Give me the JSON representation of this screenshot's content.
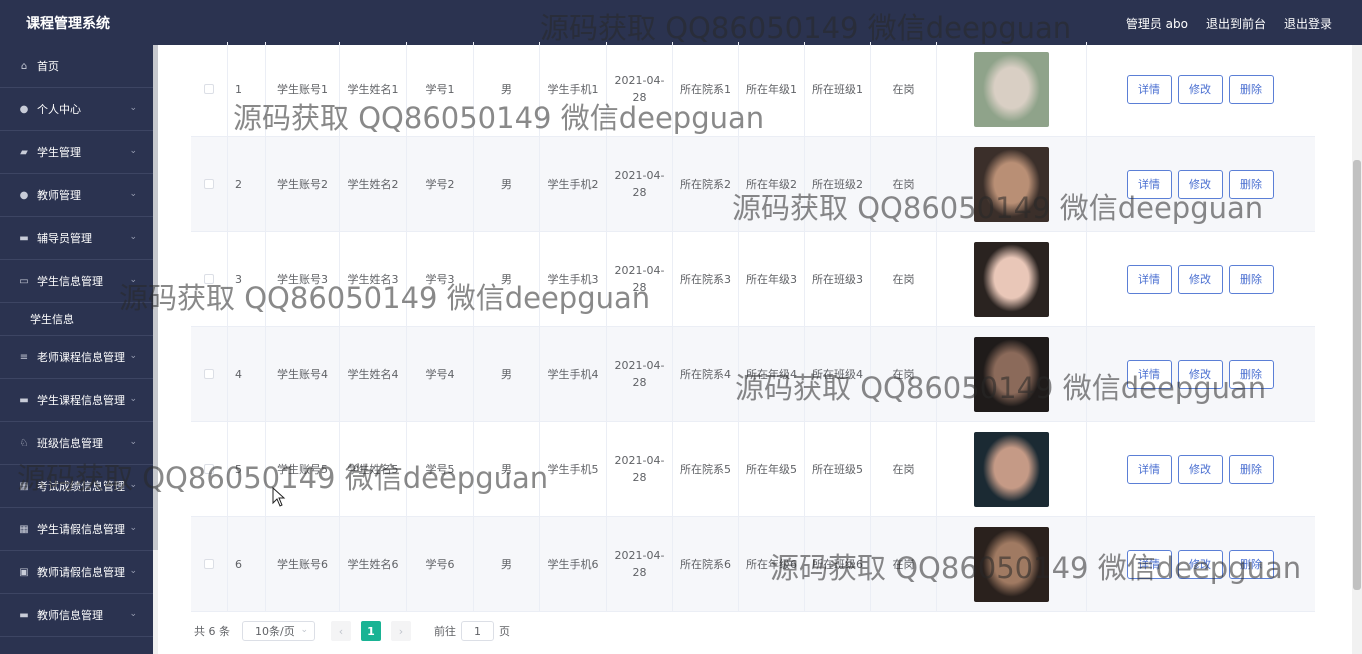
{
  "app": {
    "title": "课程管理系统"
  },
  "header": {
    "user": "管理员 abo",
    "front": "退出到前台",
    "logout": "退出登录"
  },
  "sidebar": {
    "items": [
      {
        "label": "首页",
        "icon": "home-icon",
        "glyph": "⌂"
      },
      {
        "label": "个人中心",
        "icon": "user-icon",
        "glyph": "●"
      },
      {
        "label": "学生管理",
        "icon": "student-icon",
        "glyph": "▰"
      },
      {
        "label": "教师管理",
        "icon": "teacher-icon",
        "glyph": "●"
      },
      {
        "label": "辅导员管理",
        "icon": "counselor-icon",
        "glyph": "▬"
      },
      {
        "label": "学生信息管理",
        "icon": "message-icon",
        "glyph": "▭"
      },
      {
        "label": "老师课程信息管理",
        "icon": "list-icon",
        "glyph": "≡"
      },
      {
        "label": "学生课程信息管理",
        "icon": "monitor-icon",
        "glyph": "▬"
      },
      {
        "label": "班级信息管理",
        "icon": "bell-icon",
        "glyph": "♘"
      },
      {
        "label": "考试成绩信息管理",
        "icon": "grid-icon",
        "glyph": "▦"
      },
      {
        "label": "学生请假信息管理",
        "icon": "grid-icon",
        "glyph": "▦"
      },
      {
        "label": "教师请假信息管理",
        "icon": "clipboard-icon",
        "glyph": "▣"
      },
      {
        "label": "教师信息管理",
        "icon": "monitor-icon",
        "glyph": "▬"
      }
    ],
    "sub_item": "学生信息"
  },
  "table": {
    "rows": [
      {
        "idx": "1",
        "account": "学生账号1",
        "name": "学生姓名1",
        "no": "学号1",
        "sex": "男",
        "phone": "学生手机1",
        "date1": "2021-04-",
        "date2": "28",
        "dept": "所在院系1",
        "grade": "所在年级1",
        "cls": "所在班级1",
        "status": "在岗"
      },
      {
        "idx": "2",
        "account": "学生账号2",
        "name": "学生姓名2",
        "no": "学号2",
        "sex": "男",
        "phone": "学生手机2",
        "date1": "2021-04-",
        "date2": "28",
        "dept": "所在院系2",
        "grade": "所在年级2",
        "cls": "所在班级2",
        "status": "在岗"
      },
      {
        "idx": "3",
        "account": "学生账号3",
        "name": "学生姓名3",
        "no": "学号3",
        "sex": "男",
        "phone": "学生手机3",
        "date1": "2021-04-",
        "date2": "28",
        "dept": "所在院系3",
        "grade": "所在年级3",
        "cls": "所在班级3",
        "status": "在岗"
      },
      {
        "idx": "4",
        "account": "学生账号4",
        "name": "学生姓名4",
        "no": "学号4",
        "sex": "男",
        "phone": "学生手机4",
        "date1": "2021-04-",
        "date2": "28",
        "dept": "所在院系4",
        "grade": "所在年级4",
        "cls": "所在班级4",
        "status": "在岗"
      },
      {
        "idx": "5",
        "account": "学生账号5",
        "name": "学生姓名5",
        "no": "学号5",
        "sex": "男",
        "phone": "学生手机5",
        "date1": "2021-04-",
        "date2": "28",
        "dept": "所在院系5",
        "grade": "所在年级5",
        "cls": "所在班级5",
        "status": "在岗"
      },
      {
        "idx": "6",
        "account": "学生账号6",
        "name": "学生姓名6",
        "no": "学号6",
        "sex": "男",
        "phone": "学生手机6",
        "date1": "2021-04-",
        "date2": "28",
        "dept": "所在院系6",
        "grade": "所在年级6",
        "cls": "所在班级6",
        "status": "在岗"
      }
    ],
    "btn_detail": "详情",
    "btn_edit": "修改",
    "btn_delete": "删除"
  },
  "pagination": {
    "total": "共 6 条",
    "page_size": "10条/页",
    "current": "1",
    "goto_label": "前往",
    "goto_value": "1",
    "page_unit": "页"
  },
  "watermark": "源码获取 QQ86050149 微信deepguan",
  "colors": {
    "sidebar": "#2b3350",
    "accent": "#19b394",
    "button": "#4a6fd1"
  }
}
